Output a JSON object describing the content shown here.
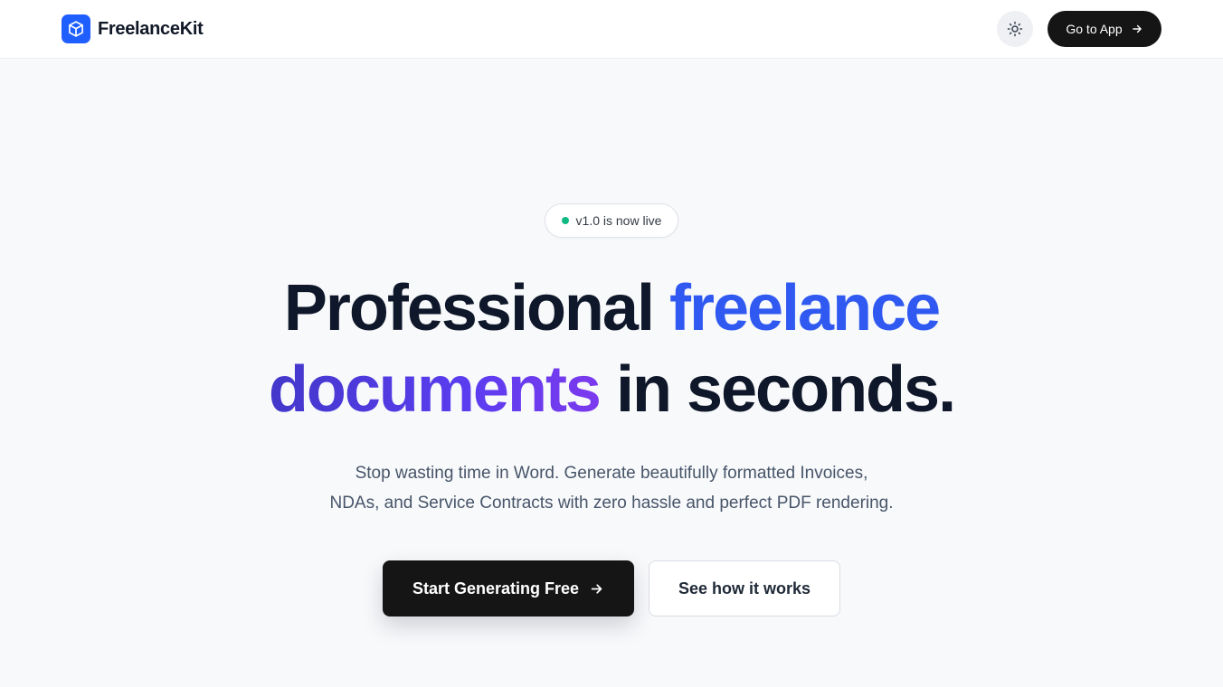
{
  "header": {
    "brand_name": "FreelanceKit",
    "go_to_app_label": "Go to App"
  },
  "hero": {
    "badge_text": "v1.0 is now live",
    "headline_part1": "Professional ",
    "headline_part2": "freelance",
    "headline_part3": "documents",
    "headline_part4": " in seconds.",
    "subtitle_line1": "Stop wasting time in Word. Generate beautifully formatted Invoices,",
    "subtitle_line2": "NDAs, and Service Contracts with zero hassle and perfect PDF rendering.",
    "primary_cta_label": "Start Generating Free",
    "secondary_cta_label": "See how it works"
  },
  "colors": {
    "accent_blue": "#2f59f0",
    "accent_purple": "#5b3df0",
    "logo_blue": "#1f5eff",
    "live_dot": "#10b981",
    "dark_button": "#151515"
  },
  "icons": {
    "logo": "cube-icon",
    "theme": "sun-icon",
    "arrow": "arrow-right-icon"
  }
}
